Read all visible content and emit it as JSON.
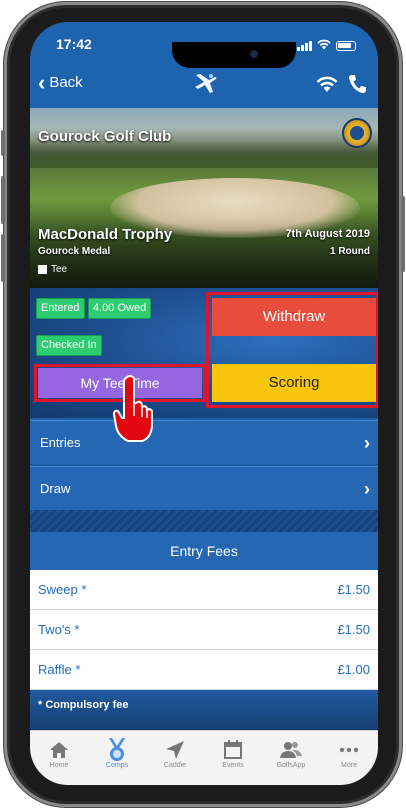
{
  "status": {
    "time": "17:42"
  },
  "nav": {
    "back_label": "Back"
  },
  "hero": {
    "club_name": "Gourock Golf Club",
    "competition_title": "MacDonald Trophy",
    "competition_subtitle": "Gourock Medal",
    "date": "7th August 2019",
    "rounds": "1 Round",
    "tee_label": "Tee"
  },
  "badges": {
    "entered": "Entered",
    "owed": "4.00 Owed",
    "checked_in": "Checked In"
  },
  "buttons": {
    "my_tee_time": "My Tee Time",
    "withdraw": "Withdraw",
    "scoring": "Scoring"
  },
  "rows": {
    "entries": "Entries",
    "draw": "Draw"
  },
  "fees": {
    "header": "Entry Fees",
    "items": [
      {
        "name": "Sweep *",
        "amount": "£1.50"
      },
      {
        "name": "Two's *",
        "amount": "£1.50"
      },
      {
        "name": "Raffle *",
        "amount": "£1.00"
      }
    ],
    "compulsory_note": "* Compulsory fee"
  },
  "tabs": [
    {
      "label": "Home",
      "icon": "home-icon"
    },
    {
      "label": "Comps",
      "icon": "medal-icon",
      "active": true
    },
    {
      "label": "Caddie",
      "icon": "navigation-arrow-icon"
    },
    {
      "label": "Events",
      "icon": "calendar-icon"
    },
    {
      "label": "GolfsApp",
      "icon": "people-icon"
    },
    {
      "label": "More",
      "icon": "more-dots-icon"
    }
  ],
  "colors": {
    "primary_blue": "#1e63ad",
    "withdraw_red": "#e74c3c",
    "scoring_yellow": "#f7c50c",
    "tee_time_purple": "#9566e0",
    "badge_green": "#2ecc71",
    "highlight_red": "#e0142a",
    "tab_active": "#4a90e2"
  }
}
